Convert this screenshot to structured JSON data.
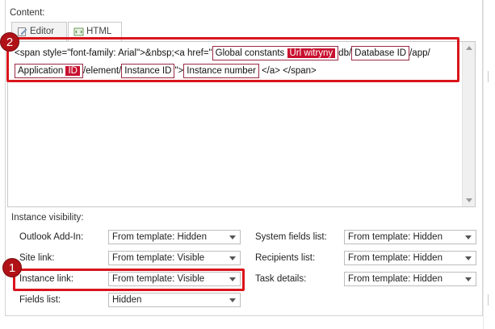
{
  "content": {
    "label": "Content:"
  },
  "tabs": [
    {
      "label": "Editor",
      "icon": "edit-icon",
      "active": false
    },
    {
      "label": "HTML",
      "icon": "html-icon",
      "active": true
    }
  ],
  "code": {
    "line1": {
      "prefix": "<span style=\"font-family: Arial\">&nbsp;<a href=\"",
      "token_global_constants": "Global constants",
      "token_url_witryny": "Url witryny",
      "sep_db": "db/",
      "token_database_id": "Database ID",
      "sep_app": "/app/"
    },
    "line2": {
      "token_application": "Application",
      "token_application_id": "ID",
      "sep_element": "/element/",
      "token_instance_id": "Instance ID",
      "sep_close": "\">",
      "token_instance_number": "Instance number",
      "suffix": "</a> </span>"
    }
  },
  "visibility": {
    "label": "Instance visibility:",
    "left": [
      {
        "label": "Outlook Add-In:",
        "value": "From template: Hidden"
      },
      {
        "label": "Site link:",
        "value": "From template: Visible"
      },
      {
        "label": "Instance link:",
        "value": "From template: Visible"
      },
      {
        "label": "Fields list:",
        "value": "Hidden"
      }
    ],
    "right": [
      {
        "label": "System fields list:",
        "value": "From template: Hidden"
      },
      {
        "label": "Recipients list:",
        "value": "From template: Hidden"
      },
      {
        "label": "Task details:",
        "value": "From template: Hidden"
      }
    ]
  },
  "annotations": [
    {
      "number": "2",
      "color": "#d9151b"
    },
    {
      "number": "1",
      "color": "#d9151b"
    }
  ],
  "colors": {
    "highlight": "#c8102e",
    "token_border": "#9a2a44",
    "annotation": "#d9151b"
  }
}
